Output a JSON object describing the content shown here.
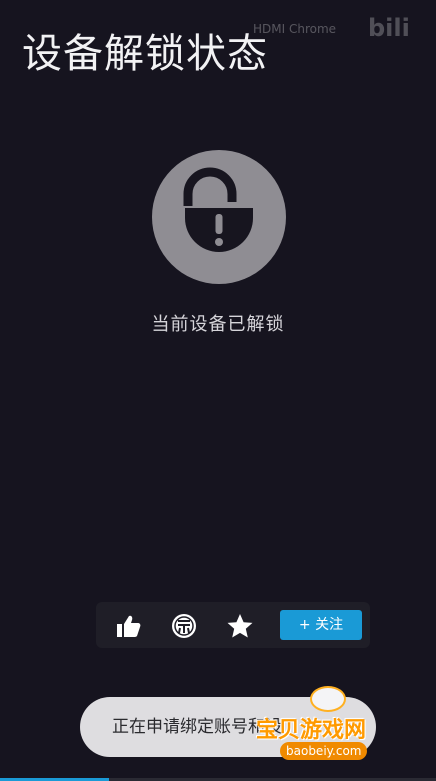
{
  "header": {
    "title": "设备解锁状态",
    "watermark": "HDMI Chrome",
    "brand": "bili"
  },
  "lock": {
    "icon": "unlocked-padlock-icon",
    "status_text": "当前设备已解锁"
  },
  "action_bar": {
    "like_icon": "thumbs-up-icon",
    "coin_icon": "coin-icon",
    "favorite_icon": "star-icon",
    "follow_label": "+ 关注",
    "accent_color": "#1a9ad6"
  },
  "toast": {
    "text": "正在申请绑定账号和设"
  },
  "site_logo": {
    "name": "宝贝游戏网",
    "url": "baobeiy.com"
  },
  "progress": {
    "fraction": 0.25
  }
}
